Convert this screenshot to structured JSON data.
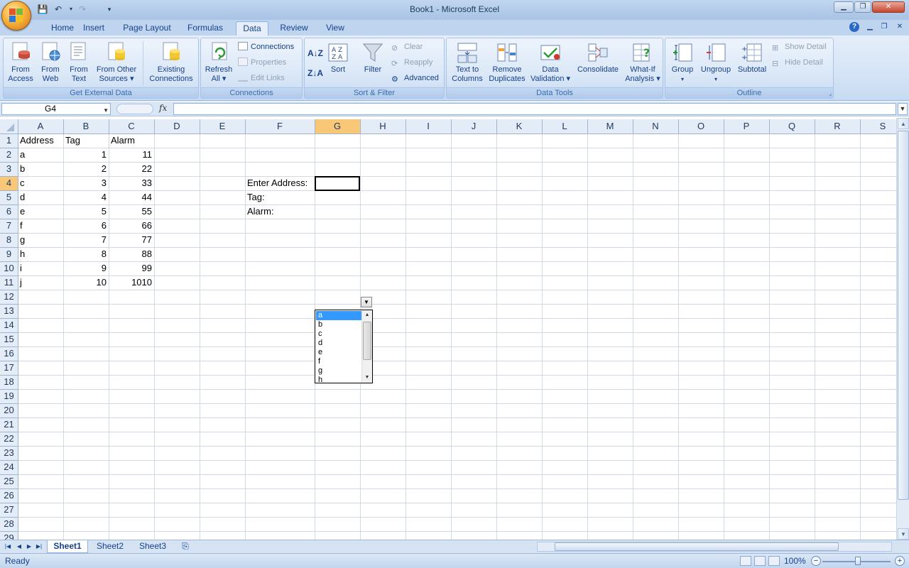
{
  "window": {
    "title": "Book1 - Microsoft Excel"
  },
  "ribbon_tabs": [
    "Home",
    "Insert",
    "Page Layout",
    "Formulas",
    "Data",
    "Review",
    "View"
  ],
  "active_tab": "Data",
  "ribbon": {
    "get_external_data": {
      "label": "Get External Data",
      "from_access": [
        "From",
        "Access"
      ],
      "from_web": [
        "From",
        "Web"
      ],
      "from_text": [
        "From",
        "Text"
      ],
      "from_other": [
        "From Other",
        "Sources ▾"
      ],
      "existing": [
        "Existing",
        "Connections"
      ]
    },
    "connections": {
      "label": "Connections",
      "refresh": [
        "Refresh",
        "All ▾"
      ],
      "connections": "Connections",
      "properties": "Properties",
      "edit_links": "Edit Links"
    },
    "sort_filter": {
      "label": "Sort & Filter",
      "sort": "Sort",
      "filter": "Filter",
      "clear": "Clear",
      "reapply": "Reapply",
      "advanced": "Advanced"
    },
    "data_tools": {
      "label": "Data Tools",
      "text_to_columns": [
        "Text to",
        "Columns"
      ],
      "remove_duplicates": [
        "Remove",
        "Duplicates"
      ],
      "data_validation": [
        "Data",
        "Validation ▾"
      ],
      "consolidate": "Consolidate",
      "what_if": [
        "What-If",
        "Analysis ▾"
      ]
    },
    "outline": {
      "label": "Outline",
      "group": "Group",
      "ungroup": "Ungroup",
      "subtotal": "Subtotal",
      "show_detail": "Show Detail",
      "hide_detail": "Hide Detail"
    }
  },
  "formula_bar": {
    "name_box": "G4",
    "fx": "fx",
    "formula": ""
  },
  "columns": [
    "A",
    "B",
    "C",
    "D",
    "E",
    "F",
    "G",
    "H",
    "I",
    "J",
    "K",
    "L",
    "M",
    "N",
    "O",
    "P",
    "Q",
    "R",
    "S"
  ],
  "active_column": "G",
  "row_count": 29,
  "active_row": 4,
  "cells": {
    "A1": "Address",
    "B1": "Tag",
    "C1": "Alarm",
    "A2": "a",
    "B2": "1",
    "C2": "11",
    "A3": "b",
    "B3": "2",
    "C3": "22",
    "A4": "c",
    "B4": "3",
    "C4": "33",
    "A5": "d",
    "B5": "4",
    "C5": "44",
    "A6": "e",
    "B6": "5",
    "C6": "55",
    "A7": "f",
    "B7": "6",
    "C7": "66",
    "A8": "g",
    "B8": "7",
    "C8": "77",
    "A9": "h",
    "B9": "8",
    "C9": "88",
    "A10": "i",
    "B10": "9",
    "C10": "99",
    "A11": "j",
    "B11": "10",
    "C11": "1010",
    "F4": "Enter Address:",
    "F5": "Tag:",
    "F6": "Alarm:"
  },
  "dropdown": {
    "items": [
      "a",
      "b",
      "c",
      "d",
      "e",
      "f",
      "g",
      "h"
    ],
    "selected": "a"
  },
  "sheets": [
    "Sheet1",
    "Sheet2",
    "Sheet3"
  ],
  "active_sheet": "Sheet1",
  "status": {
    "ready": "Ready",
    "zoom": "100%"
  },
  "colors": {
    "accent": "#15428b",
    "selection": "#3399ff",
    "active_header": "#f8c878"
  }
}
